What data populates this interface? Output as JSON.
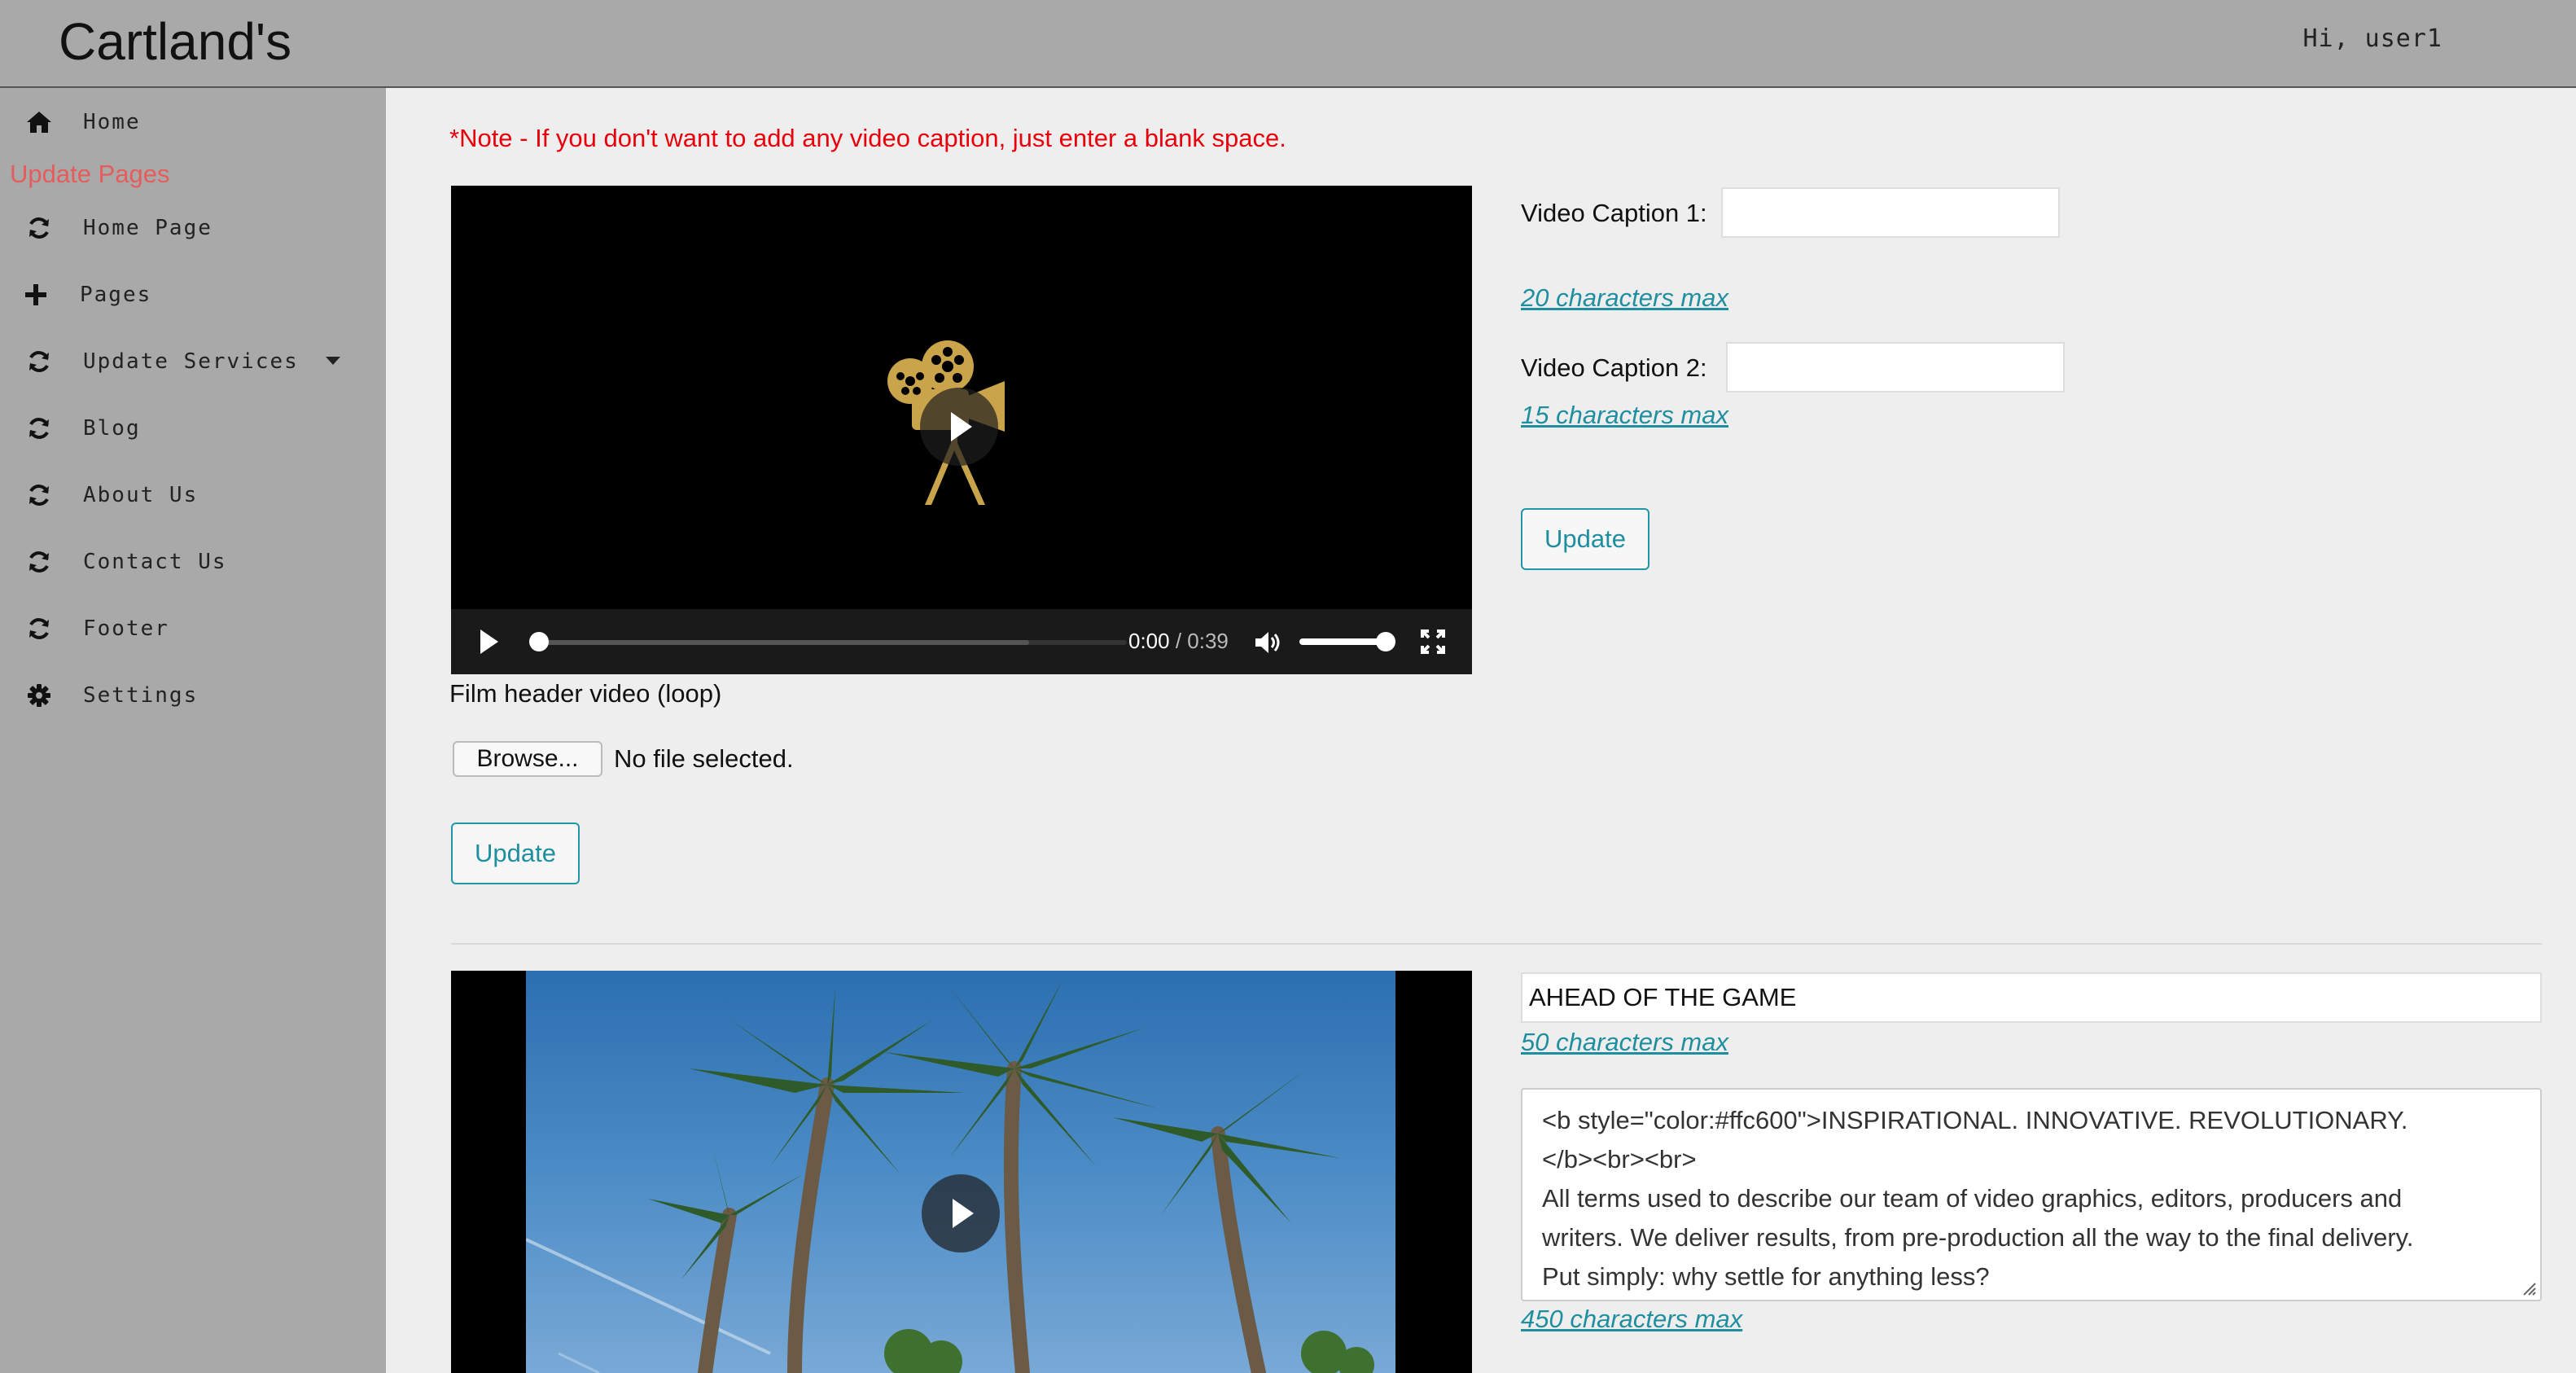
{
  "header": {
    "brand": "Cartland's",
    "greeting": "Hi, user1"
  },
  "sidebar": {
    "heading": "Update Pages",
    "items": [
      {
        "label": "Home",
        "icon": "home-icon"
      },
      {
        "label": "Home Page",
        "icon": "refresh-icon"
      },
      {
        "label": "Pages",
        "icon": "plus-icon"
      },
      {
        "label": "Update Services",
        "icon": "refresh-icon",
        "has_dropdown": true
      },
      {
        "label": "Blog",
        "icon": "refresh-icon"
      },
      {
        "label": "About Us",
        "icon": "refresh-icon"
      },
      {
        "label": "Contact Us",
        "icon": "refresh-icon"
      },
      {
        "label": "Footer",
        "icon": "refresh-icon"
      },
      {
        "label": "Settings",
        "icon": "gear-icon"
      }
    ]
  },
  "main": {
    "note": "*Note - If you don't want to add any video caption, just enter a blank space.",
    "video1": {
      "current_time": "0:00",
      "duration": "/ 0:39",
      "progress_fraction": 0,
      "volume_fraction": 1,
      "label": "Film header video (loop)",
      "browse_label": "Browse...",
      "file_status": "No file selected.",
      "update_label": "Update"
    },
    "captions": {
      "caption1_label": "Video Caption 1:",
      "caption1_value": "",
      "caption1_limit": "20 characters max",
      "caption2_label": "Video Caption 2:",
      "caption2_value": "",
      "caption2_limit": "15 characters max",
      "update_label": "Update"
    },
    "section2": {
      "headline_value": "AHEAD OF THE GAME",
      "headline_limit": "50 characters max",
      "body_lines": [
        "<b style=\"color:#ffc600\">INSPIRATIONAL. INNOVATIVE. REVOLUTIONARY.",
        "</b><br><br>",
        "All terms used to describe our team of video graphics, editors, producers and",
        "writers. We deliver results, from pre-production all the way to the final delivery.",
        "Put simply: why settle for anything less?"
      ],
      "body_limit": "450 characters max"
    }
  },
  "colors": {
    "accent": "#1f8fa0",
    "note": "#e8000b",
    "sidebar_heading": "#e65c5c",
    "sidebar_bg": "#a9a9a9"
  }
}
